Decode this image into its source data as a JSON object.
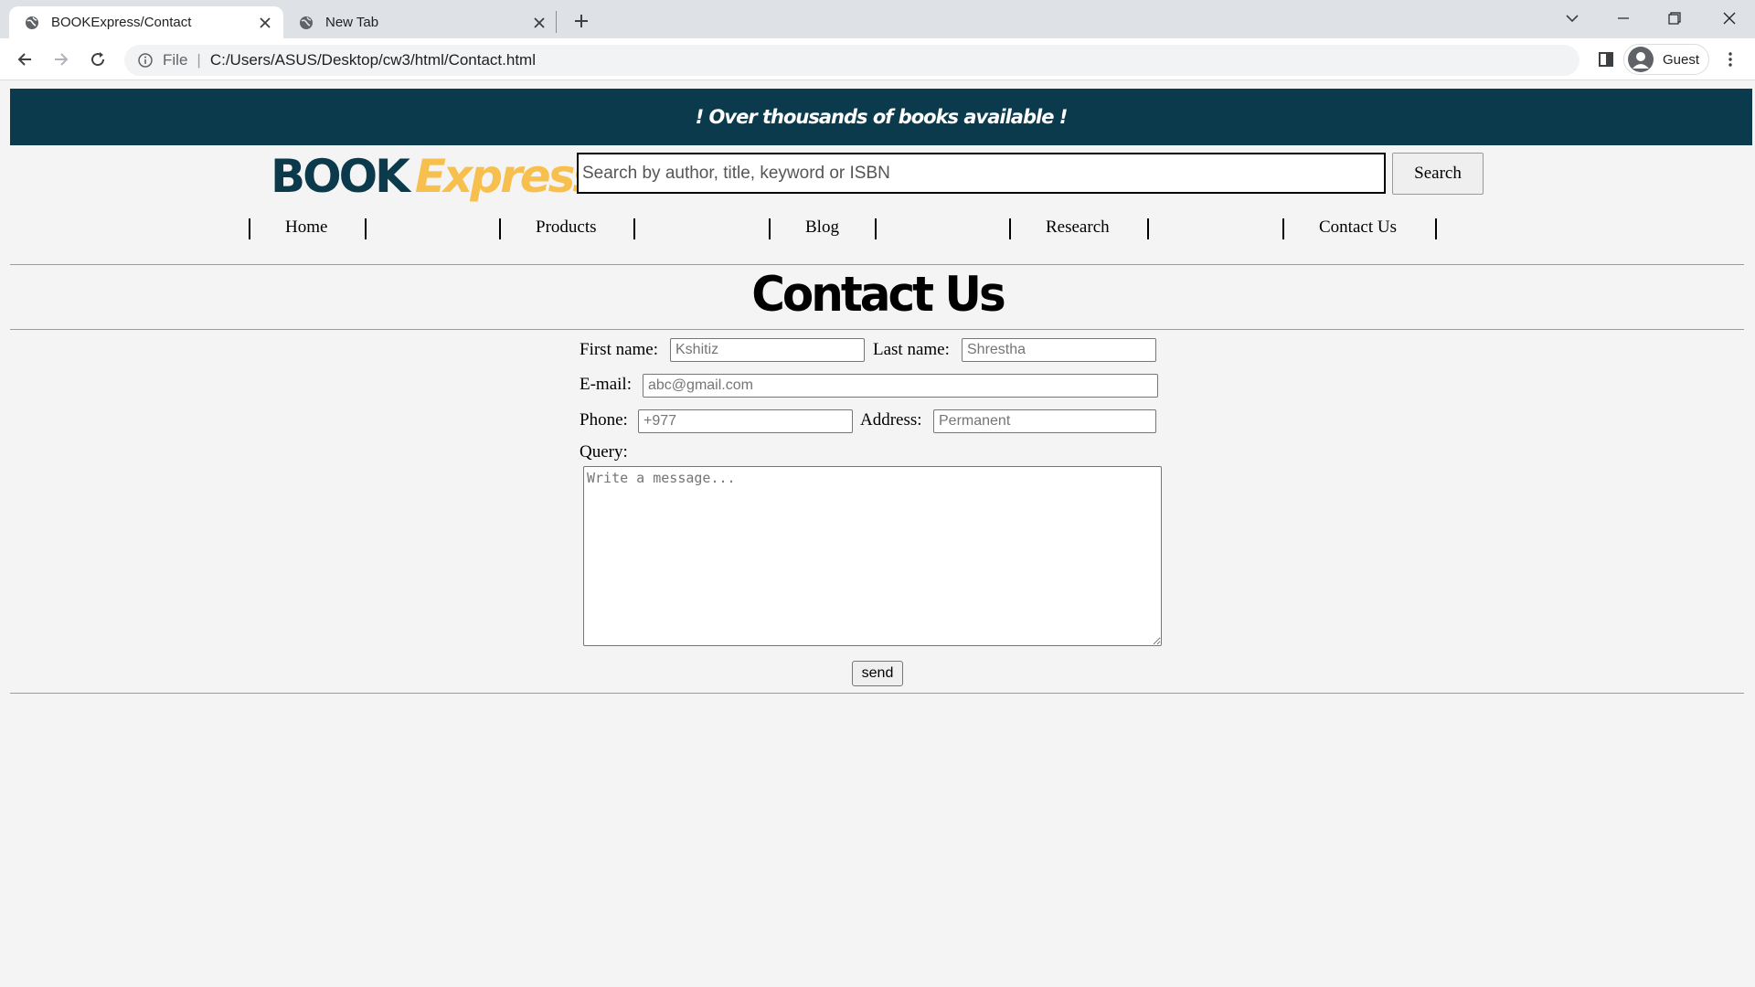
{
  "browser": {
    "tabs": [
      {
        "title": "BOOKExpress/Contact",
        "active": true
      },
      {
        "title": "New Tab",
        "active": false
      }
    ],
    "address": {
      "scheme_label": "File",
      "url": "C:/Users/ASUS/Desktop/cw3/html/Contact.html"
    },
    "profile_label": "Guest"
  },
  "page": {
    "banner_text": "! Over thousands of books available !",
    "logo": {
      "part1": "BOOK",
      "part2": "Express"
    },
    "search": {
      "placeholder": "Search by author, title, keyword or ISBN",
      "button_label": "Search"
    },
    "nav": {
      "home": "Home",
      "products": "Products",
      "blog": "Blog",
      "research": "Research",
      "contact": "Contact Us"
    },
    "title": "Contact Us",
    "form": {
      "first_name_label": "First name:",
      "first_name_placeholder": "Kshitiz",
      "last_name_label": "Last name:",
      "last_name_placeholder": "Shrestha",
      "email_label": "E-mail:",
      "email_placeholder": "abc@gmail.com",
      "phone_label": "Phone:",
      "phone_placeholder": "+977",
      "address_label": "Address:",
      "address_placeholder": "Permanent",
      "query_label": "Query:",
      "query_placeholder": "Write a message...",
      "send_label": "send"
    }
  },
  "colors": {
    "banner": "#0b3a4c",
    "logo_primary": "#0b3a4c",
    "logo_accent": "#f7c04e"
  }
}
